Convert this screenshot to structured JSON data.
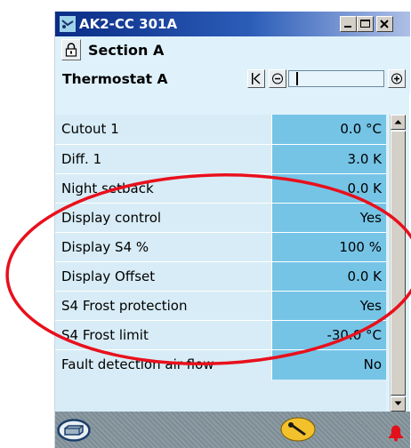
{
  "window": {
    "title": "AK2-CC 301A",
    "caption_buttons": [
      "minimize",
      "maximize",
      "close"
    ]
  },
  "section": {
    "title": "Section A",
    "lock_icon": "lock-icon"
  },
  "thermostat": {
    "title": "Thermostat A",
    "nav_icons": [
      "first-page-icon",
      "previous-icon",
      "next-icon"
    ]
  },
  "parameters": [
    {
      "label": "Cutout 1",
      "value": "0.0 °C"
    },
    {
      "label": "Diff. 1",
      "value": "3.0 K"
    },
    {
      "label": "Night setback",
      "value": "0.0 K"
    },
    {
      "label": "Display control",
      "value": "Yes"
    },
    {
      "label": "Display S4 %",
      "value": "100 %"
    },
    {
      "label": "Display Offset",
      "value": "0.0 K"
    },
    {
      "label": "S4 Frost protection",
      "value": "Yes"
    },
    {
      "label": "S4 Frost limit",
      "value": "-30.0 °C"
    },
    {
      "label": "Fault detection air flow",
      "value": "No"
    }
  ],
  "bottom_bar": {
    "icons": [
      "display-case-icon",
      "wrench-icon",
      "alarm-bell-icon"
    ]
  },
  "annotation": {
    "shape": "ellipse",
    "color": "#e8101c"
  }
}
